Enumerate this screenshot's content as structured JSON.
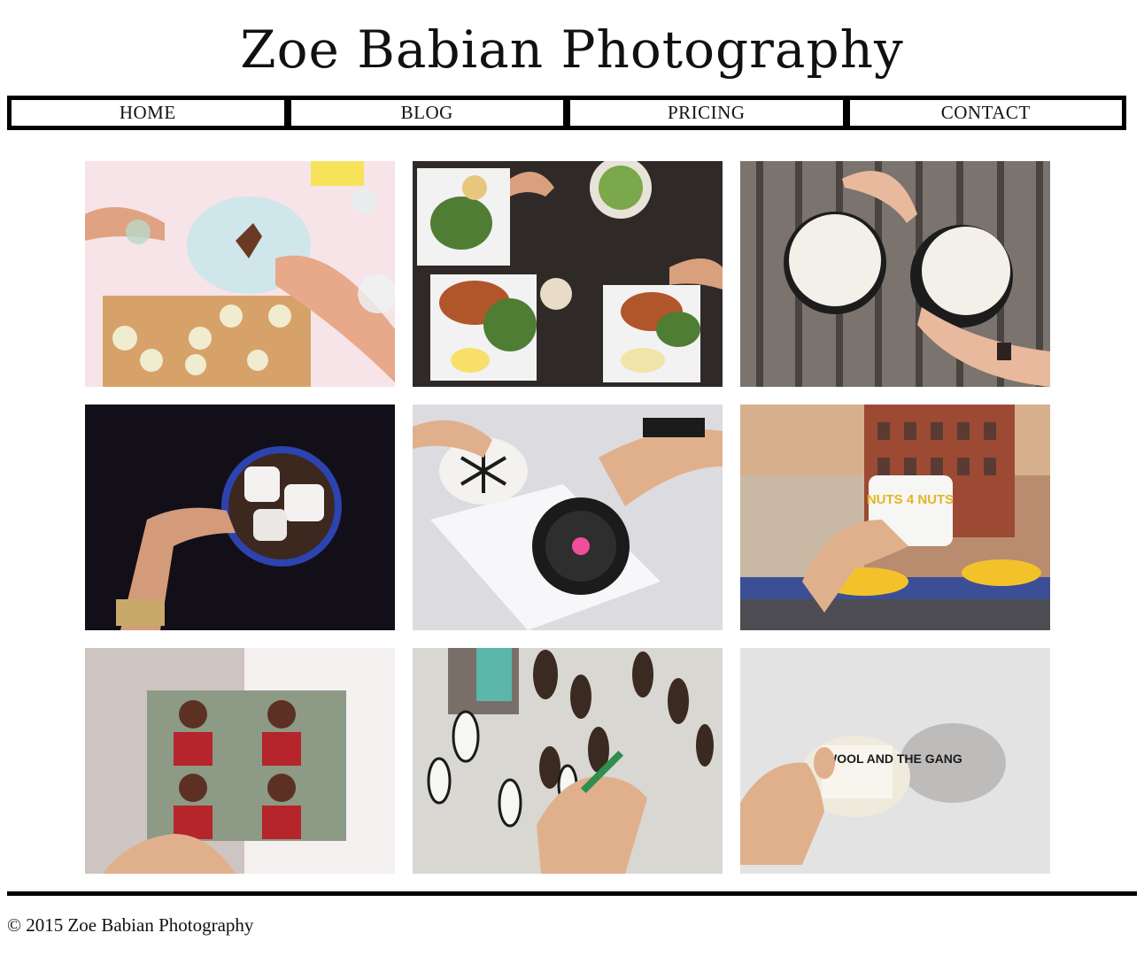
{
  "site": {
    "title": "Zoe Babian Photography"
  },
  "nav": {
    "items": [
      {
        "label": "HOME"
      },
      {
        "label": "BLOG"
      },
      {
        "label": "PRICING"
      },
      {
        "label": "CONTACT"
      }
    ]
  },
  "gallery": {
    "photos": [
      {
        "subject": "cooking-zucchini-on-cutting-board",
        "tones": [
          "#f6e4e8",
          "#d7a26a",
          "#cfe6ea"
        ]
      },
      {
        "subject": "brunch-table-overhead",
        "tones": [
          "#2f2a28",
          "#f2f2f2",
          "#4f7d33"
        ]
      },
      {
        "subject": "coffee-cups-on-wooden-bench",
        "tones": [
          "#7b736d",
          "#f3f0ea",
          "#e8b99c"
        ]
      },
      {
        "subject": "hot-cocoa-with-marshmallows",
        "tones": [
          "#120f18",
          "#2c43b0",
          "#f4f2f0"
        ]
      },
      {
        "subject": "decorated-cookie-in-hands",
        "tones": [
          "#dcdbdf",
          "#1b1b1b",
          "#f04d9b"
        ]
      },
      {
        "subject": "nuts-4-nuts-bag-in-city",
        "tones": [
          "#b98c6f",
          "#f3c22b",
          "#3c4f96"
        ]
      },
      {
        "subject": "portrait-prints-in-hand",
        "tones": [
          "#f3f0ef",
          "#8c9a86",
          "#b5252b"
        ]
      },
      {
        "subject": "painting-pinecones-on-newspaper",
        "tones": [
          "#d9d7d2",
          "#3b2a21",
          "#2f8f4f"
        ]
      },
      {
        "subject": "wool-and-the-gang-yarn",
        "tones": [
          "#e3e3e3",
          "#efeadc",
          "#1b1b1b"
        ]
      }
    ],
    "labels": {
      "nuts": "NUTS 4 NUTS",
      "wool": "WOOL AND THE GANG"
    }
  },
  "footer": {
    "copyright": "© 2015 Zoe Babian Photography"
  }
}
